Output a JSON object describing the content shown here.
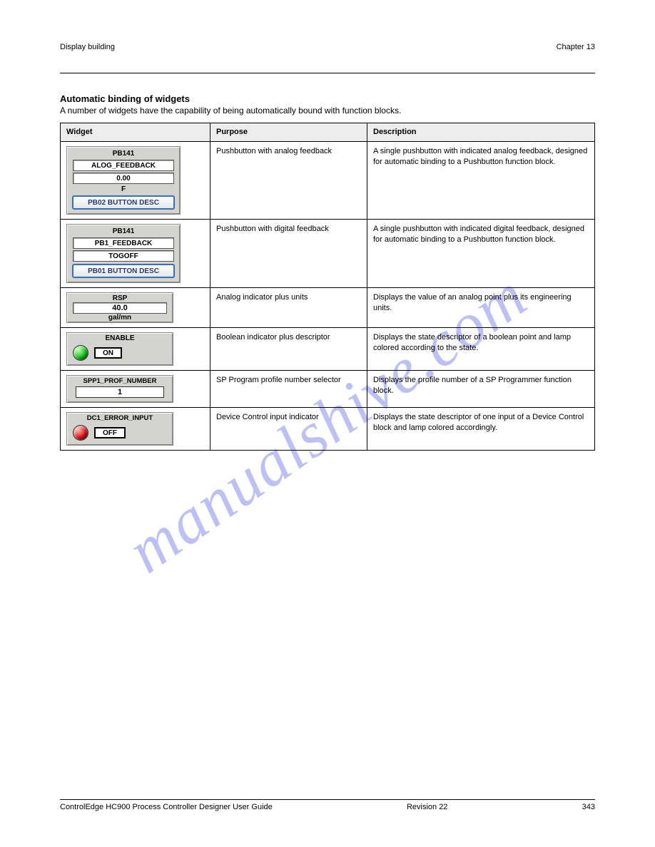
{
  "watermark": "manualshive.com",
  "header": {
    "left": "Display building",
    "right": "Chapter 13"
  },
  "section": {
    "title": "Automatic binding of widgets",
    "body": "A number of widgets have the capability of being automatically bound with function blocks."
  },
  "table": {
    "headers": [
      "Widget",
      "Purpose",
      "Description"
    ],
    "rows": [
      {
        "purpose": "Pushbutton with analog feedback",
        "description": "A single pushbutton with indicated analog feedback, designed for automatic binding to a Pushbutton function block.",
        "widget": {
          "type": "pb-analog",
          "title": "PB141",
          "feedback_label": "ALOG_FEEDBACK",
          "value": "0.00",
          "unit": "F",
          "button_label": "PB02 BUTTON DESC"
        }
      },
      {
        "purpose": "Pushbutton with digital feedback",
        "description": "A single pushbutton with indicated digital feedback, designed for automatic binding to a Pushbutton function block.",
        "widget": {
          "type": "pb-digital",
          "title": "PB141",
          "feedback_label": "PB1_FEEDBACK",
          "state": "TOGOFF",
          "button_label": "PB01 BUTTON DESC"
        }
      },
      {
        "purpose": "Analog indicator plus units",
        "description": "Displays the value of an analog point plus its engineering units.",
        "widget": {
          "type": "analog-units",
          "title": "RSP",
          "value": "40.0",
          "unit": "gal/mn"
        }
      },
      {
        "purpose": "Boolean indicator plus descriptor",
        "description": "Displays the state descriptor of a boolean point and lamp colored according to the state.",
        "widget": {
          "type": "bool-lamp",
          "title": "ENABLE",
          "lamp": "green",
          "state": "ON"
        }
      },
      {
        "purpose": "SP Program profile number selector",
        "description": "Displays the profile number of a SP Programmer function block.",
        "widget": {
          "type": "numeric",
          "title": "SPP1_PROF_NUMBER",
          "value": "1"
        }
      },
      {
        "purpose": "Device Control input indicator",
        "description": "Displays the state descriptor of one input of a Device Control block and lamp colored accordingly.",
        "widget": {
          "type": "bool-lamp",
          "title": "DC1_ERROR_INPUT",
          "lamp": "red",
          "state": "OFF"
        }
      }
    ]
  },
  "footer": {
    "left": "ControlEdge HC900 Process Controller Designer User Guide",
    "right": "Revision 22",
    "page": "343"
  }
}
